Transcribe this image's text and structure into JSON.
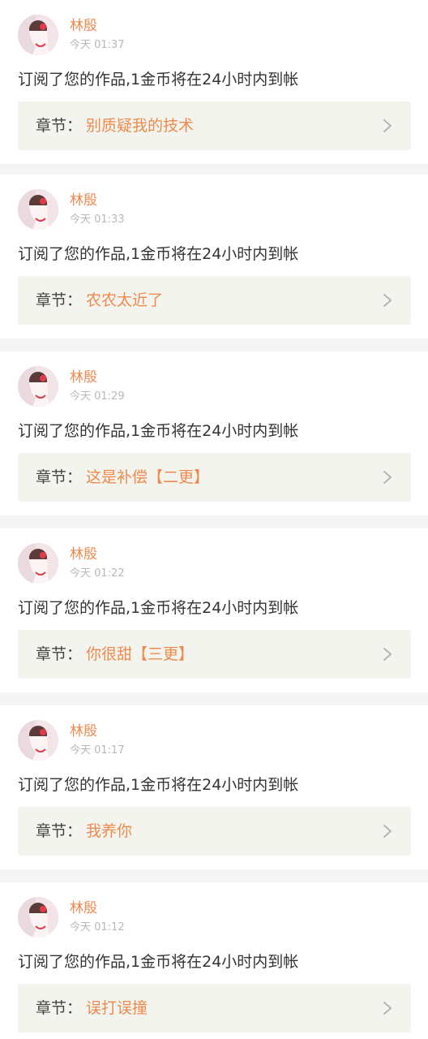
{
  "theme": {
    "accent": "#ef8a4f",
    "time_color": "#b9b9b9",
    "chapter_bg": "#f4f4ef",
    "page_bg": "#f4f4f4"
  },
  "notifications": [
    {
      "user_name": "林殷",
      "time": "今天 01:37",
      "message": "订阅了您的作品,1金币将在24小时内到帐",
      "chapter_prefix": "章节：",
      "chapter_title": "别质疑我的技术",
      "icon": "chevron-right-icon"
    },
    {
      "user_name": "林殷",
      "time": "今天 01:33",
      "message": "订阅了您的作品,1金币将在24小时内到帐",
      "chapter_prefix": "章节：",
      "chapter_title": "农农太近了",
      "icon": "chevron-right-icon"
    },
    {
      "user_name": "林殷",
      "time": "今天 01:29",
      "message": "订阅了您的作品,1金币将在24小时内到帐",
      "chapter_prefix": "章节：",
      "chapter_title": "这是补偿【二更】",
      "icon": "chevron-right-icon"
    },
    {
      "user_name": "林殷",
      "time": "今天 01:22",
      "message": "订阅了您的作品,1金币将在24小时内到帐",
      "chapter_prefix": "章节：",
      "chapter_title": "你很甜【三更】",
      "icon": "chevron-right-icon"
    },
    {
      "user_name": "林殷",
      "time": "今天 01:17",
      "message": "订阅了您的作品,1金币将在24小时内到帐",
      "chapter_prefix": "章节：",
      "chapter_title": "我养你",
      "icon": "chevron-right-icon"
    },
    {
      "user_name": "林殷",
      "time": "今天 01:12",
      "message": "订阅了您的作品,1金币将在24小时内到帐",
      "chapter_prefix": "章节：",
      "chapter_title": "误打误撞",
      "icon": "chevron-right-icon"
    }
  ]
}
